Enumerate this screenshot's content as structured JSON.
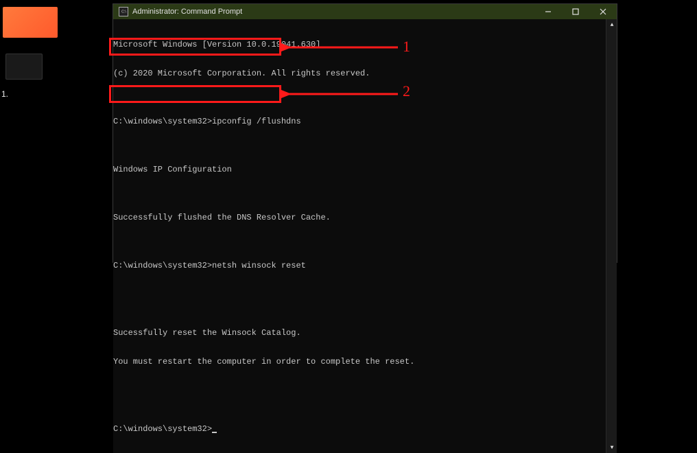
{
  "desktop": {
    "item1_label": "",
    "item2_label": "1."
  },
  "window": {
    "title": "Administrator: Command Prompt"
  },
  "terminal": {
    "lines": [
      "Microsoft Windows [Version 10.0.19041.630]",
      "(c) 2020 Microsoft Corporation. All rights reserved.",
      "",
      "C:\\windows\\system32>ipconfig /flushdns",
      "",
      "Windows IP Configuration",
      "",
      "Successfully flushed the DNS Resolver Cache.",
      "",
      "C:\\windows\\system32>netsh winsock reset",
      "",
      "",
      "Sucessfully reset the Winsock Catalog.",
      "You must restart the computer in order to complete the reset.",
      "",
      "",
      "C:\\windows\\system32>"
    ],
    "cursor_line_prefix": "C:\\windows\\system32>"
  },
  "titlebar_icon_text": "C:\\",
  "annotations": {
    "num1": "1",
    "num2": "2"
  }
}
